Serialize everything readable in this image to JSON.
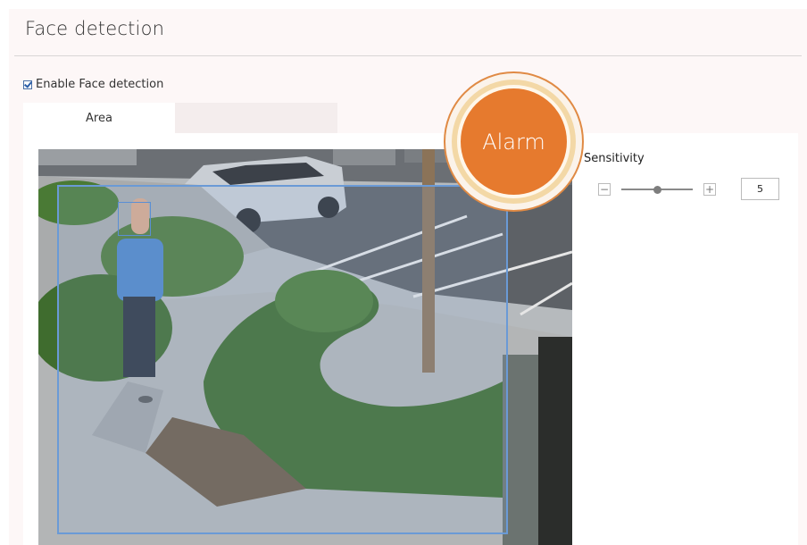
{
  "header": {
    "title": "Face detection"
  },
  "options": {
    "enable_label": "Enable Face detection",
    "enabled": true
  },
  "tabs": [
    {
      "label": "Area",
      "active": true
    }
  ],
  "alarm": {
    "label": "Alarm",
    "color": "#e67a2e"
  },
  "sensitivity": {
    "label": "Sensitivity",
    "value": "5",
    "level": 0.5,
    "minus_icon": "minus-icon",
    "plus_icon": "plus-icon"
  },
  "colors": {
    "accent": "#e67a2e",
    "region": "#6a9ad6"
  }
}
